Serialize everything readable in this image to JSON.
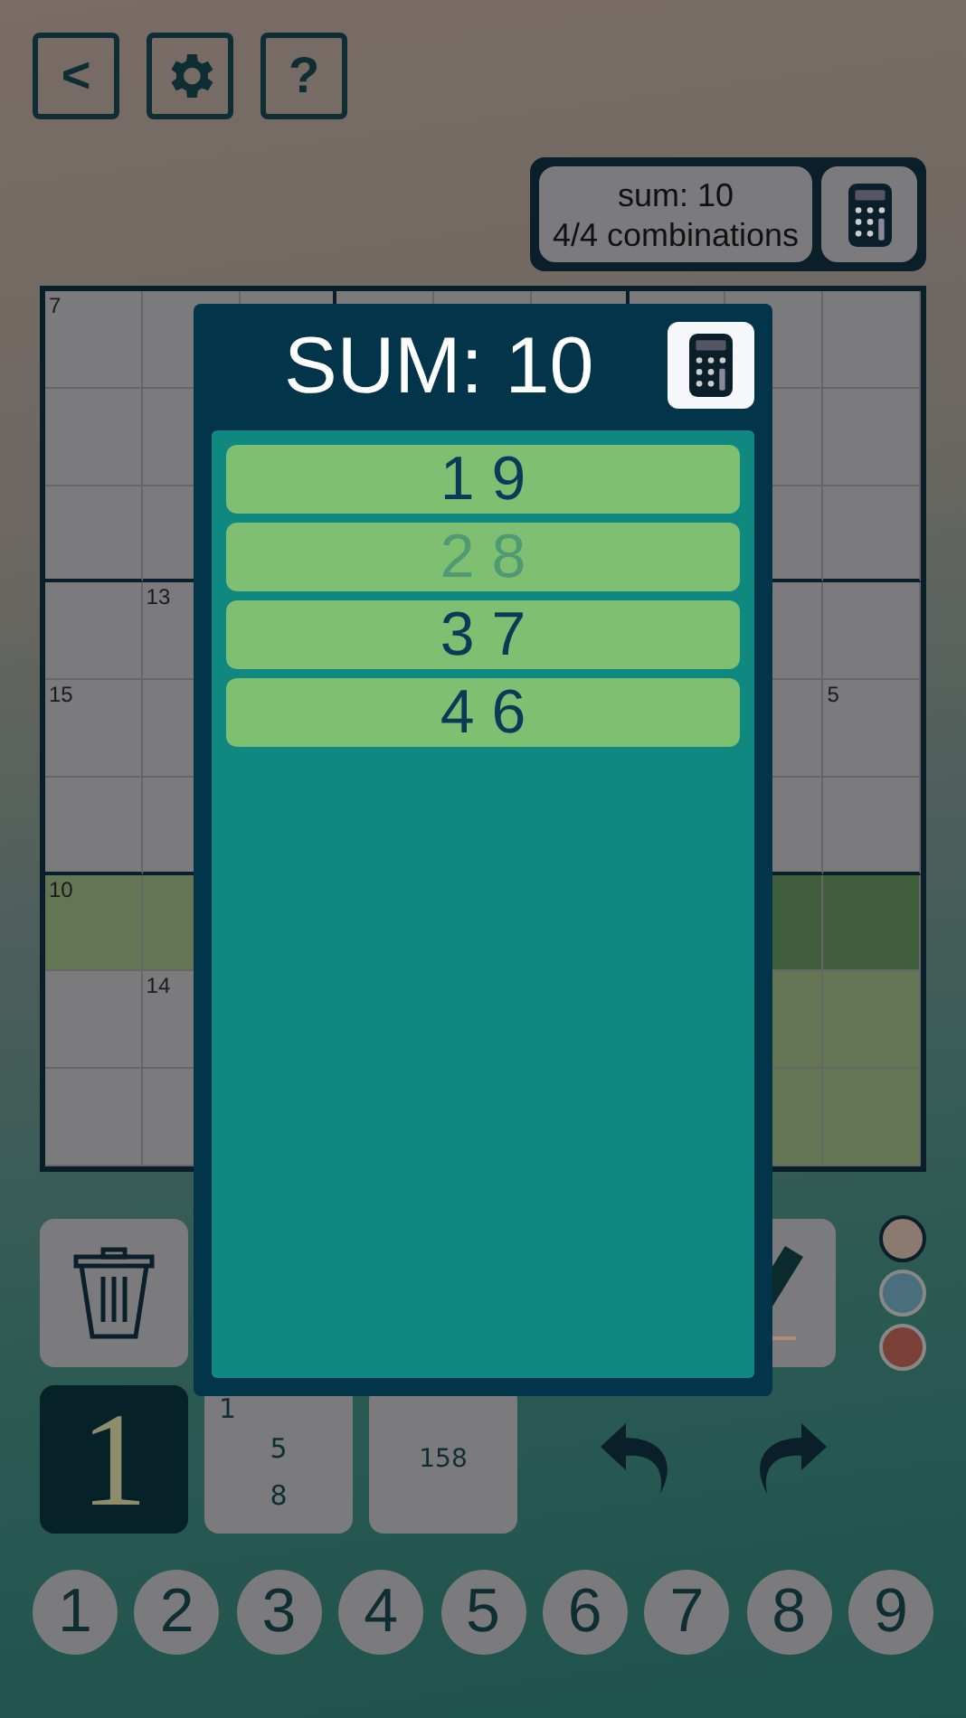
{
  "toolbar": [
    {
      "kind": "back",
      "label": "<"
    },
    {
      "kind": "settings"
    },
    {
      "kind": "help",
      "label": "?"
    }
  ],
  "sum_info": {
    "sum": "sum: 10",
    "combinations": "4/4 combinations"
  },
  "grid": {
    "rows": [
      {
        "cells": [
          {
            "row_highlight": false,
            "box_highlight": false,
            "cage_sum": "7"
          },
          {
            "row_highlight": false,
            "box_highlight": false
          },
          null,
          null,
          null,
          null,
          null,
          {
            "row_highlight": false,
            "box_highlight": false
          },
          {
            "row_highlight": false,
            "box_highlight": false
          }
        ]
      },
      {
        "cells": [
          {
            "row_highlight": false,
            "box_highlight": false
          },
          {
            "row_highlight": false,
            "box_highlight": false
          },
          null,
          null,
          null,
          null,
          null,
          {
            "row_highlight": false,
            "box_highlight": false
          },
          {
            "row_highlight": false,
            "box_highlight": false
          }
        ]
      },
      {
        "cells": [
          {
            "row_highlight": false,
            "box_highlight": false
          },
          {
            "row_highlight": false,
            "box_highlight": false
          },
          null,
          null,
          null,
          null,
          null,
          {
            "row_highlight": false,
            "box_highlight": false
          },
          {
            "row_highlight": false,
            "box_highlight": false
          }
        ]
      },
      {
        "cells": [
          {
            "row_highlight": false,
            "box_highlight": false
          },
          {
            "row_highlight": false,
            "box_highlight": false,
            "cage_sum": "13"
          },
          null,
          null,
          null,
          null,
          null,
          {
            "row_highlight": false,
            "box_highlight": false
          },
          {
            "row_highlight": false,
            "box_highlight": false
          }
        ]
      },
      {
        "cells": [
          {
            "row_highlight": false,
            "box_highlight": false,
            "cage_sum": "15"
          },
          {
            "row_highlight": false,
            "box_highlight": false
          },
          null,
          null,
          null,
          null,
          null,
          {
            "row_highlight": false,
            "box_highlight": false
          },
          {
            "row_highlight": false,
            "box_highlight": false,
            "cage_sum": "5"
          }
        ]
      },
      {
        "cells": [
          {
            "row_highlight": false,
            "box_highlight": false
          },
          {
            "row_highlight": false,
            "box_highlight": false
          },
          null,
          null,
          null,
          null,
          null,
          {
            "row_highlight": false,
            "box_highlight": false
          },
          {
            "row_highlight": false,
            "box_highlight": false
          }
        ]
      },
      {
        "cells": [
          {
            "row_highlight": true,
            "box_highlight": false,
            "cage_sum": "10"
          },
          {
            "row_highlight": true,
            "box_highlight": false
          },
          null,
          null,
          null,
          null,
          null,
          {
            "row_highlight": true,
            "box_highlight": true
          },
          {
            "row_highlight": true,
            "box_highlight": true
          }
        ]
      },
      {
        "cells": [
          {
            "row_highlight": false,
            "box_highlight": false
          },
          {
            "row_highlight": false,
            "box_highlight": false,
            "cage_sum": "14"
          },
          null,
          null,
          null,
          null,
          null,
          {
            "row_highlight": false,
            "box_highlight": true
          },
          {
            "row_highlight": false,
            "box_highlight": true
          }
        ]
      },
      {
        "cells": [
          {
            "row_highlight": false,
            "box_highlight": false
          },
          {
            "row_highlight": false,
            "box_highlight": false
          },
          null,
          null,
          null,
          null,
          null,
          {
            "row_highlight": false,
            "box_highlight": true
          },
          {
            "row_highlight": false,
            "box_highlight": true
          }
        ]
      }
    ]
  },
  "tools": [
    {
      "kind": "delete"
    },
    {
      "kind": "pencil"
    }
  ],
  "colors": [
    {
      "color": "#8a7a70",
      "selected": true
    },
    {
      "color": "#4b6e7c",
      "selected": false
    },
    {
      "color": "#7a3f36",
      "selected": false
    }
  ],
  "modes": [
    {
      "kind": "normal",
      "label": "1",
      "selected": true
    },
    {
      "kind": "corner",
      "marks": [
        "1",
        "5",
        "8"
      ],
      "selected": false
    },
    {
      "kind": "center",
      "label": "158",
      "selected": false
    }
  ],
  "history": [
    {
      "kind": "undo"
    },
    {
      "kind": "redo"
    }
  ],
  "digits": [
    "1",
    "2",
    "3",
    "4",
    "5",
    "6",
    "7",
    "8",
    "9"
  ],
  "dialog": {
    "title": "SUM: 10",
    "combinations": [
      {
        "digits": "1 9",
        "excluded": false
      },
      {
        "digits": "2 8",
        "excluded": true
      },
      {
        "digits": "3 7",
        "excluded": false
      },
      {
        "digits": "4 6",
        "excluded": false
      }
    ]
  }
}
